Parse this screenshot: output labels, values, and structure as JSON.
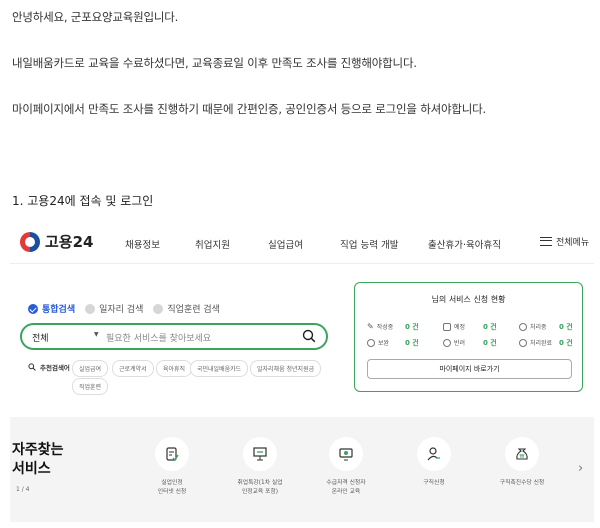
{
  "paragraphs": {
    "greeting": "안녕하세요, 군포요양교육원입니다.",
    "p2": "내일배움카드로 교육을 수료하셨다면, 교육종료일 이후 만족도 조사를 진행해야합니다.",
    "p3": "마이페이지에서 만족도 조사를 진행하기 때문에 간편인증, 공인인증서 등으로 로그인을 하셔야합니다."
  },
  "heading": "1. 고용24에 접속 및 로그인",
  "site": {
    "logo_text": "고용24",
    "nav": [
      "채용정보",
      "취업지원",
      "실업급여",
      "직업 능력 개발",
      "출산휴가·육아휴직"
    ],
    "all_menu": "전체메뉴",
    "tabs": [
      "통합검색",
      "일자리 검색",
      "직업훈련 검색"
    ],
    "search": {
      "category": "전체",
      "placeholder": "필요한 서비스를 찾아보세요"
    },
    "recommend_label": "추천검색어",
    "chips": [
      "실업급여",
      "근로계약서",
      "육아휴직",
      "국민내일배움카드",
      "일자리채움 청년지원금",
      "직업훈련"
    ],
    "service_box": {
      "title": "님의 서비스 신청 현황",
      "stats": [
        {
          "label": "작성중",
          "value": "0 건",
          "icon": "pencil-icon"
        },
        {
          "label": "예정",
          "value": "0 건",
          "icon": "calendar-icon"
        },
        {
          "label": "처리중",
          "value": "0 건",
          "icon": "dots-icon"
        },
        {
          "label": "보완",
          "value": "0 건",
          "icon": "alert-icon"
        },
        {
          "label": "반려",
          "value": "0 건",
          "icon": "x-icon"
        },
        {
          "label": "처리완료",
          "value": "0 건",
          "icon": "check-icon"
        }
      ],
      "mypage_button": "마이페이지 바로가기"
    },
    "frequent": {
      "title_line1": "자주찾는",
      "title_line2": "서비스",
      "page": "1 / 4",
      "items": [
        {
          "label": "실업인정\n인터넷 신청",
          "icon": "document-icon"
        },
        {
          "label": "취업특강(1차 실업\n인정교육 포함)",
          "icon": "presentation-icon"
        },
        {
          "label": "수급자격 신청자\n온라인 교육",
          "icon": "monitor-icon"
        },
        {
          "label": "구직신청",
          "icon": "person-icon"
        },
        {
          "label": "구직촉진수당 신청",
          "icon": "money-bag-icon"
        }
      ]
    },
    "colors": {
      "green": "#3aa45c",
      "blue": "#2a5bd7"
    }
  }
}
